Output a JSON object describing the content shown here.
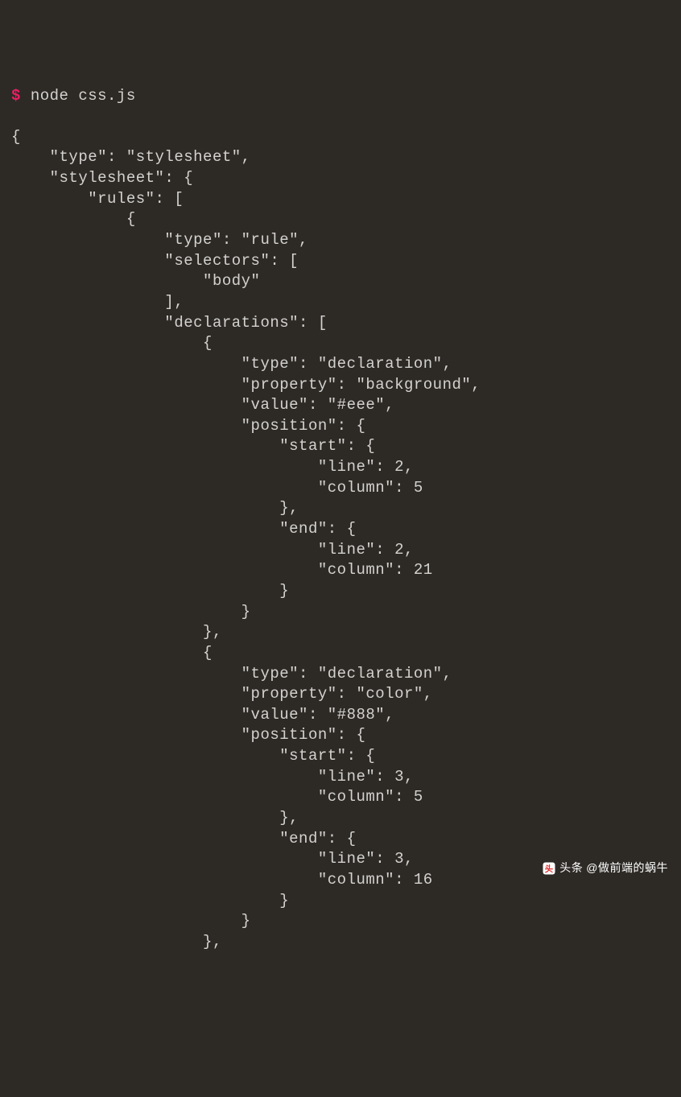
{
  "prompt": "$",
  "command": "node css.js",
  "watermark": {
    "label": "头条",
    "handle": "@做前端的蜗牛"
  },
  "output_lines": [
    "{",
    "    \"type\": \"stylesheet\",",
    "    \"stylesheet\": {",
    "        \"rules\": [",
    "            {",
    "                \"type\": \"rule\",",
    "                \"selectors\": [",
    "                    \"body\"",
    "                ],",
    "                \"declarations\": [",
    "                    {",
    "                        \"type\": \"declaration\",",
    "                        \"property\": \"background\",",
    "                        \"value\": \"#eee\",",
    "                        \"position\": {",
    "                            \"start\": {",
    "                                \"line\": 2,",
    "                                \"column\": 5",
    "                            },",
    "                            \"end\": {",
    "                                \"line\": 2,",
    "                                \"column\": 21",
    "                            }",
    "                        }",
    "                    },",
    "                    {",
    "                        \"type\": \"declaration\",",
    "                        \"property\": \"color\",",
    "                        \"value\": \"#888\",",
    "                        \"position\": {",
    "                            \"start\": {",
    "                                \"line\": 3,",
    "                                \"column\": 5",
    "                            },",
    "                            \"end\": {",
    "                                \"line\": 3,",
    "                                \"column\": 16",
    "                            }",
    "                        }",
    "                    },"
  ]
}
